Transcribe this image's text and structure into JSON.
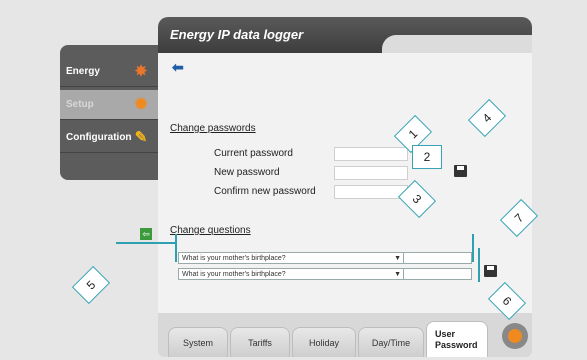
{
  "sidebar": {
    "items": [
      {
        "label": "Energy",
        "icon": "energy-icon"
      },
      {
        "label": "Setup",
        "icon": "setup-icon"
      },
      {
        "label": "Configuration",
        "icon": "configuration-icon"
      }
    ]
  },
  "app": {
    "title": "Energy IP data logger"
  },
  "passwords": {
    "section_title": "Change passwords",
    "current_label": "Current password",
    "new_label": "New password",
    "confirm_label": "Confirm new password",
    "current_value": "",
    "new_value": "",
    "confirm_value": ""
  },
  "questions": {
    "section_title": "Change questions",
    "rows": [
      {
        "question": "What is your mother's birthplace?",
        "answer": ""
      },
      {
        "question": "What is your mother's birthplace?",
        "answer": ""
      }
    ]
  },
  "tabs": [
    {
      "label": "System"
    },
    {
      "label": "Tariffs"
    },
    {
      "label": "Holiday"
    },
    {
      "label": "Day/Time"
    },
    {
      "label": "User Password",
      "active": true
    }
  ],
  "callouts": [
    "1",
    "2",
    "3",
    "4",
    "5",
    "6",
    "7"
  ],
  "colors": {
    "accent": "#2f9fb2",
    "brand_orange": "#f08a20",
    "back_arrow": "#1e5fa8"
  }
}
